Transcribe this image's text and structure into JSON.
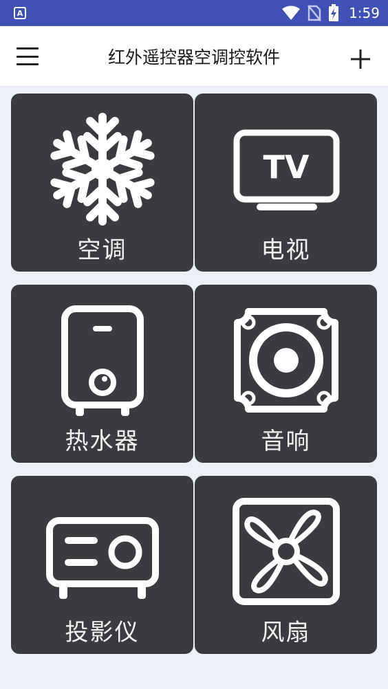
{
  "status_bar": {
    "app_icon_letter": "A",
    "time": "1:59"
  },
  "app_bar": {
    "title": "红外遥控器空调控软件",
    "menu_icon": "hamburger-menu-icon",
    "add_icon": "plus-icon"
  },
  "devices": [
    {
      "label": "空调",
      "icon": "snowflake-icon"
    },
    {
      "label": "电视",
      "icon": "tv-icon"
    },
    {
      "label": "热水器",
      "icon": "water-heater-icon"
    },
    {
      "label": "音响",
      "icon": "speaker-icon"
    },
    {
      "label": "投影仪",
      "icon": "projector-icon"
    },
    {
      "label": "风扇",
      "icon": "fan-icon"
    }
  ],
  "tv_icon_text": "TV",
  "colors": {
    "status_bar": "#3f51b5",
    "tile_background": "#3a3b3f",
    "page_background": "#eef0f8"
  }
}
